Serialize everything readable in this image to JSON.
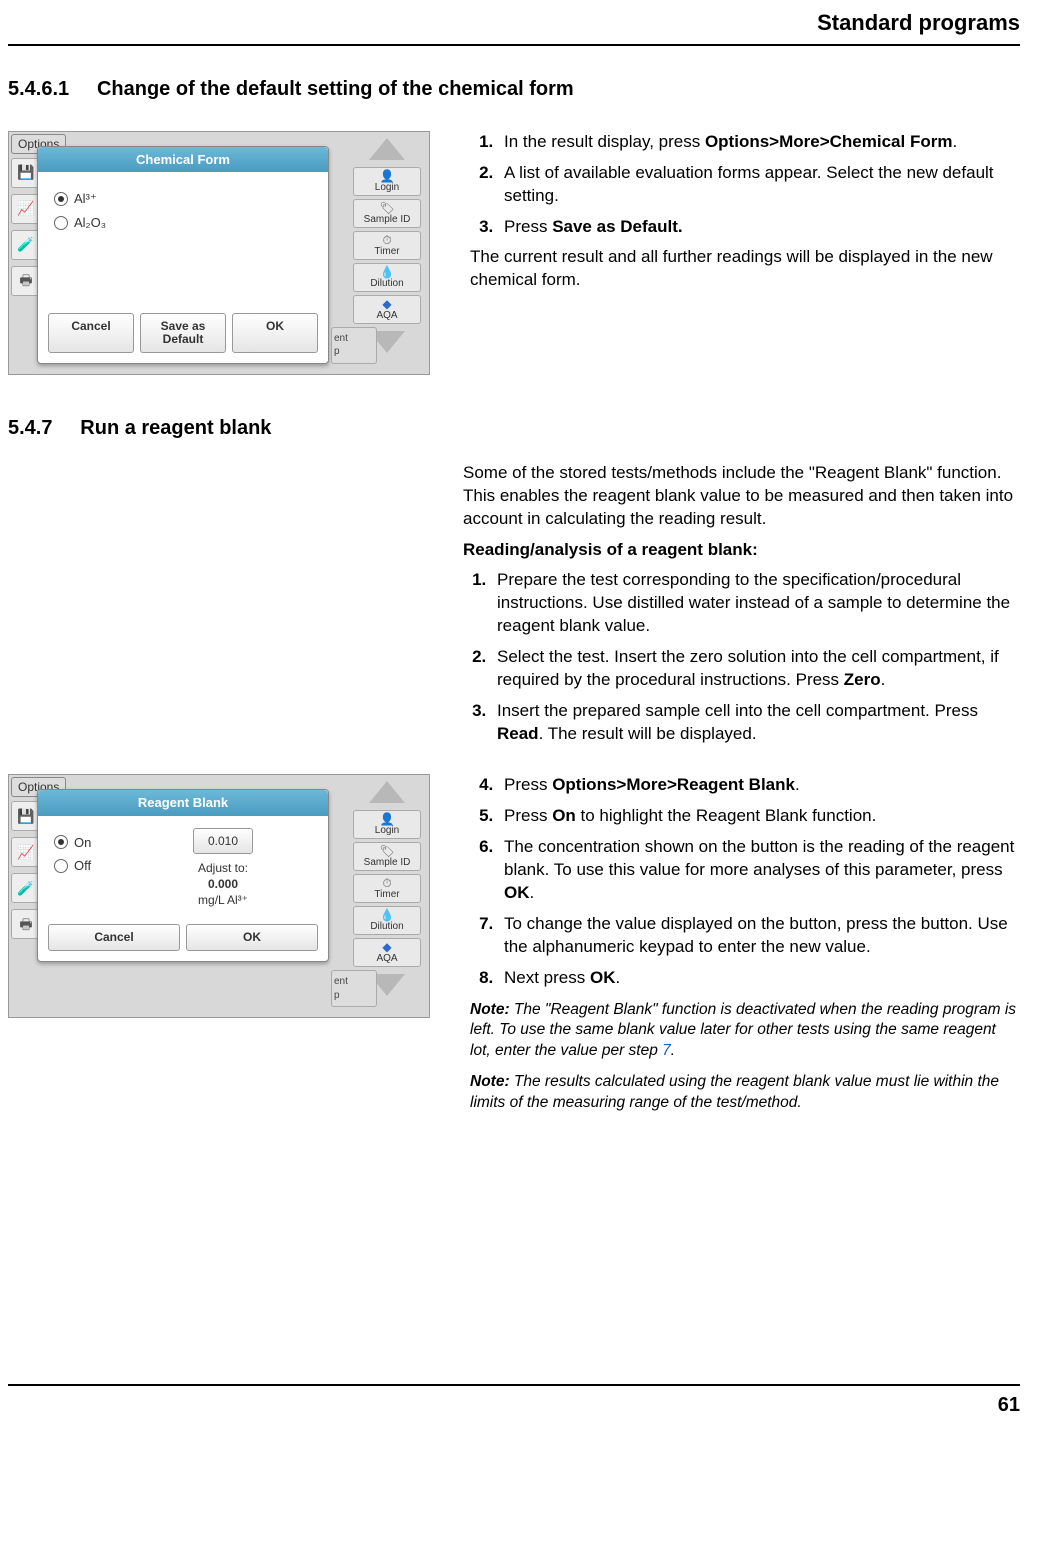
{
  "running_head": "Standard programs",
  "page_number": "61",
  "section1": {
    "number": "5.4.6.1",
    "title": "Change of the default setting of the chemical form",
    "steps": [
      {
        "pre": "In the result display, press ",
        "bold": "Options>More>Chemical Form",
        "post": "."
      },
      {
        "pre": "A list of available evaluation forms appear. Select the new default setting.",
        "bold": "",
        "post": ""
      },
      {
        "pre": "Press ",
        "bold": "Save as Default.",
        "post": ""
      }
    ],
    "trail": "The current result and all further readings will be displayed in the new chemical form."
  },
  "section2": {
    "number": "5.4.7",
    "title": "Run a reagent blank",
    "intro": "Some of the stored tests/methods include the \"Reagent Blank\" function. This enables the reagent blank value to be measured and then taken into account in calculating the reading result.",
    "subhead": "Reading/analysis of a reagent blank:",
    "steps_a": [
      {
        "pre": "Prepare the test corresponding to the specification/procedural instructions. Use distilled water instead of a sample to determine the reagent blank value.",
        "bold": "",
        "post": ""
      },
      {
        "pre": "Select the test. Insert the zero solution into the cell compartment, if required by the procedural instructions. Press ",
        "bold": "Zero",
        "post": "."
      },
      {
        "pre": "Insert the prepared sample cell into the cell compartment. Press ",
        "bold": "Read",
        "post": ". The result will be displayed."
      }
    ],
    "steps_b": [
      {
        "pre": "Press ",
        "bold": "Options>More>Reagent Blank",
        "post": "."
      },
      {
        "pre": "Press ",
        "bold": "On",
        "post": " to highlight the Reagent Blank function."
      },
      {
        "pre": "The concentration shown on the button is the reading of the reagent blank. To use this value for more analyses of this parameter, press ",
        "bold": "OK",
        "post": "."
      },
      {
        "pre": "To change the value displayed on the button, press the button. Use the alphanumeric keypad to enter the new value.",
        "bold": "",
        "post": ""
      },
      {
        "pre": "Next press ",
        "bold": "OK",
        "post": "."
      }
    ],
    "note1_pre": "The \"Reagent Blank\" function is deactivated when the reading program is left. To use the same blank value later for other tests using the same reagent lot, enter the value per step ",
    "note1_link": "7",
    "note1_post": ".",
    "note2": "The results calculated using the reagent blank value must lie within the limits of the measuring range of the test/method.",
    "note_label": "Note:"
  },
  "shot_common": {
    "options_tab": "Options",
    "sidebar": {
      "login": "Login",
      "sample_id": "Sample ID",
      "timer": "Timer",
      "dilution": "Dilution",
      "aqa": "AQA"
    },
    "bg_btn": "ent\np"
  },
  "shot1": {
    "title": "Chemical Form",
    "opt1": "Al³⁺",
    "opt2": "Al₂O₃",
    "cancel": "Cancel",
    "save": "Save as\nDefault",
    "ok": "OK"
  },
  "shot2": {
    "title": "Reagent Blank",
    "on": "On",
    "off": "Off",
    "value": "0.010",
    "adjust_label": "Adjust to:",
    "adjust_value": "0.000",
    "unit": "mg/L Al³⁺",
    "cancel": "Cancel",
    "ok": "OK"
  }
}
